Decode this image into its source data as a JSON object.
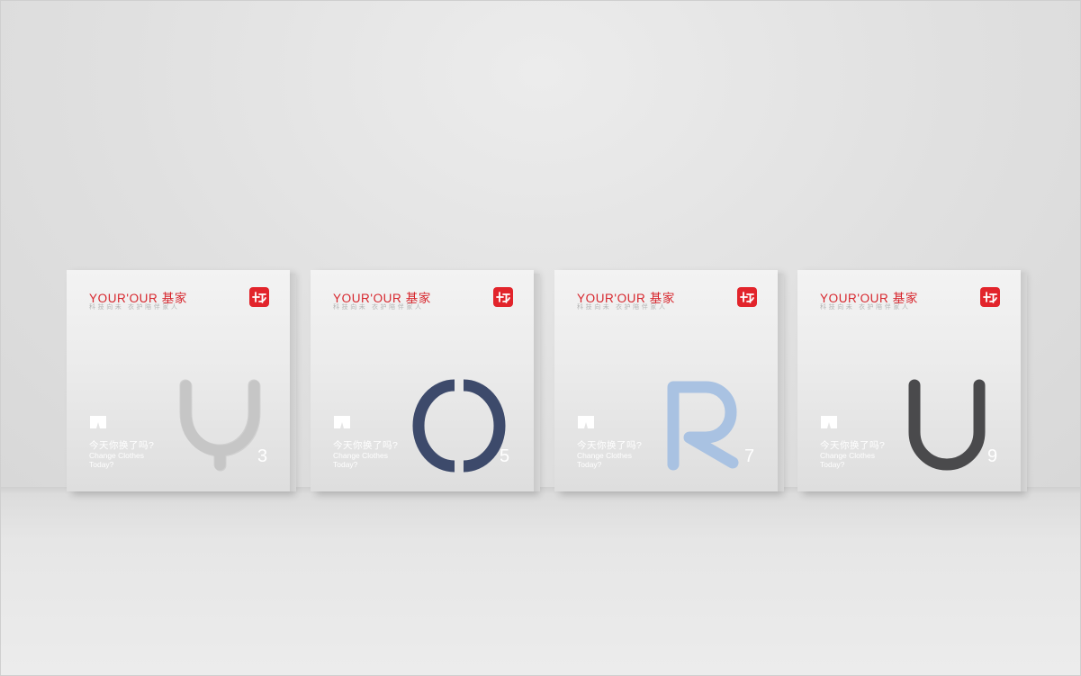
{
  "brand": "YOUR'OUR 基家",
  "slogan": "科技向未 衣护陪伴家人",
  "question_cn": "今天你换了吗?",
  "question_en": "Change Clothes Today?",
  "products": [
    {
      "letter": "Y",
      "number": "3",
      "letter_color": "#c8c8c8"
    },
    {
      "letter": "O",
      "number": "5",
      "letter_color": "#3d4a6b"
    },
    {
      "letter": "R",
      "number": "7",
      "letter_color": "#a9c2e2"
    },
    {
      "letter": "U",
      "number": "9",
      "letter_color": "#4a4a4c"
    }
  ],
  "colors": {
    "accent": "#e2242b",
    "background": "#dedede"
  }
}
